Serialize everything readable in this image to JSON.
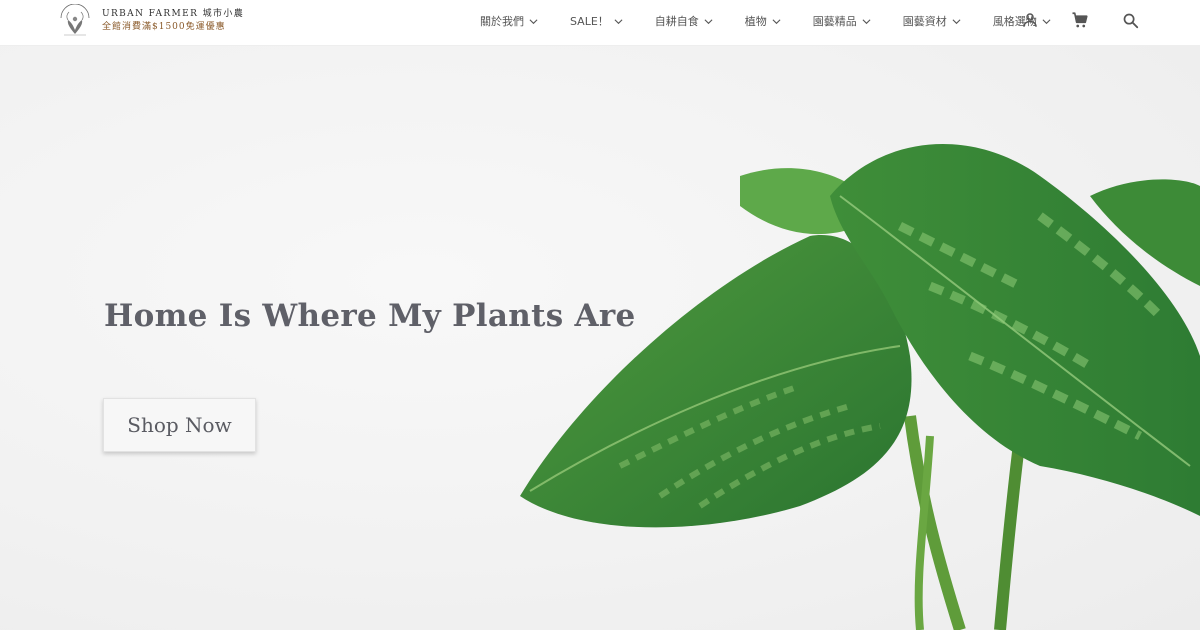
{
  "brand": {
    "name": "URBAN FARMER 城市小農",
    "promo": "全館消費滿$1500免運優惠",
    "mark_text": "URBAN FARMER"
  },
  "nav": {
    "items": [
      {
        "label": "關於我們"
      },
      {
        "label": "SALE！"
      },
      {
        "label": "自耕自食"
      },
      {
        "label": "植物"
      },
      {
        "label": "園藝精品"
      },
      {
        "label": "園藝資材"
      },
      {
        "label": "風格選物"
      }
    ]
  },
  "header_icons": [
    "account-icon",
    "cart-icon",
    "search-icon"
  ],
  "hero": {
    "title": "Home Is Where My Plants Are",
    "cta_label": "Shop Now"
  },
  "colors": {
    "leaf_dark": "#2f7f32",
    "leaf_light": "#7bbf6a",
    "text": "#5f6068",
    "promo": "#8a5a2a"
  }
}
